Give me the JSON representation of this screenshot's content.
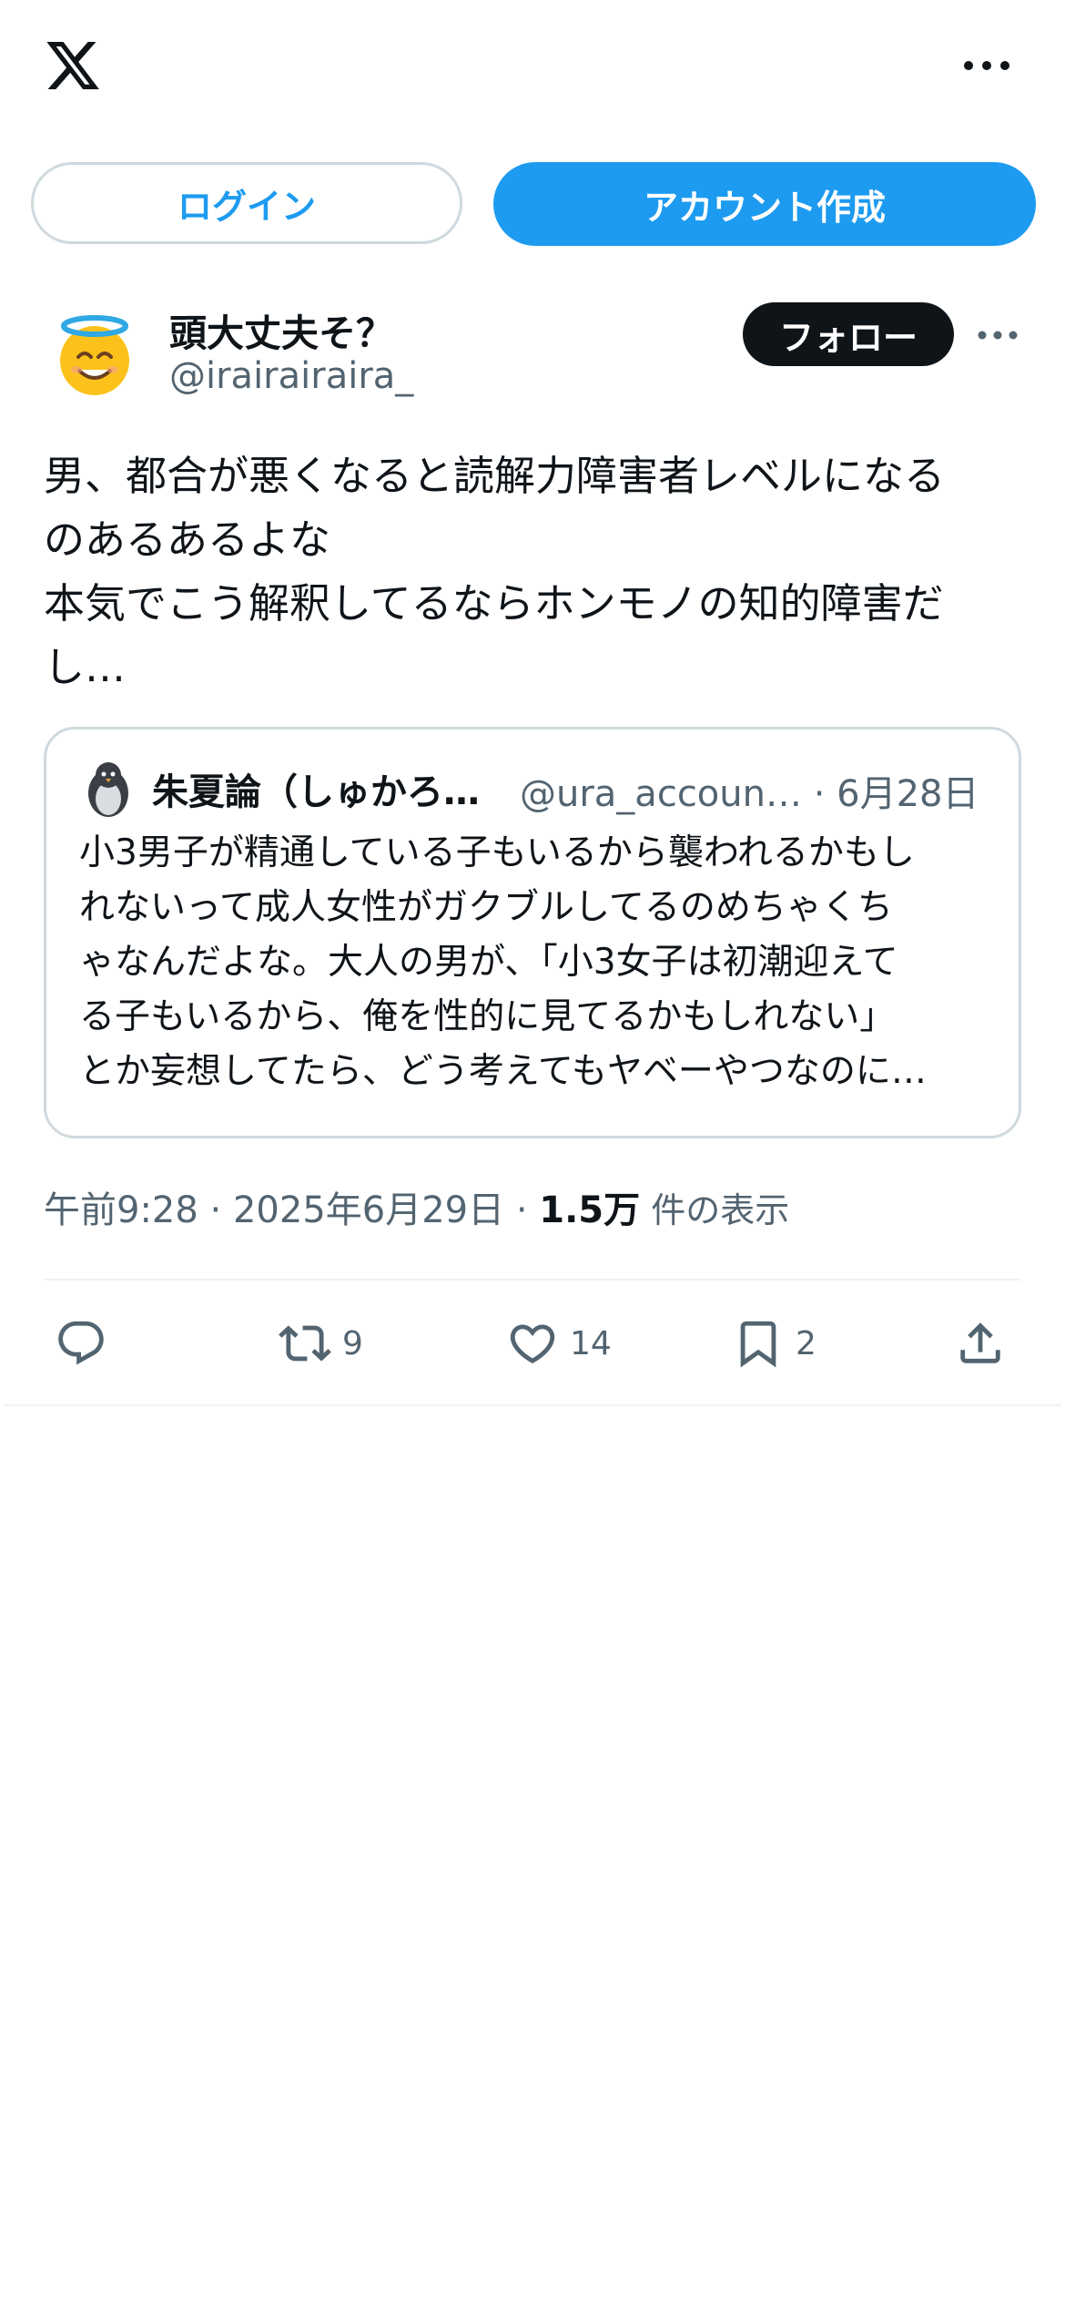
{
  "header": {
    "logo_icon": "x-logo-icon",
    "more_icon": "more-horizontal-icon"
  },
  "auth": {
    "login_label": "ログイン",
    "signup_label": "アカウント作成"
  },
  "author": {
    "display_name": "頭大丈夫そ？",
    "handle": "@irairairaira_",
    "avatar_icon": "smiling-face-with-halo-emoji",
    "follow_label": "フォロー"
  },
  "tweet": {
    "lines": [
      "男、都合が悪くなると読解力障害者レベルになる",
      "のあるあるよな",
      "本気でこう解釈してるならホンモノの知的障害だ",
      "し…"
    ]
  },
  "quote": {
    "avatar_icon": "penguin-avatar",
    "name": "朱夏論（しゅかろ…",
    "handle_date": "@ura_accoun… · 6月28日",
    "lines": [
      "小3男子が精通している子もいるから襲われるかもし",
      "れないって成人女性がガクブルしてるのめちゃくち",
      "ゃなんだよな。大人の男が、「小3女子は初潮迎えて",
      "る子もいるから、俺を性的に見てるかもしれない」",
      "とか妄想してたら、どう考えてもヤベーやつなのに…"
    ]
  },
  "meta": {
    "time_date": "午前9:28 · 2025年6月29日 · ",
    "views_count": "1.5万",
    "views_label": " 件の表示"
  },
  "actions": {
    "reply_icon": "reply-icon",
    "retweet_icon": "retweet-icon",
    "retweet_count": "9",
    "like_icon": "heart-icon",
    "like_count": "14",
    "bookmark_icon": "bookmark-icon",
    "bookmark_count": "2",
    "share_icon": "share-icon"
  },
  "colors": {
    "accent": "#1d9bf0",
    "text": "#0f1419",
    "secondary": "#536471",
    "border": "#cfd9de"
  }
}
